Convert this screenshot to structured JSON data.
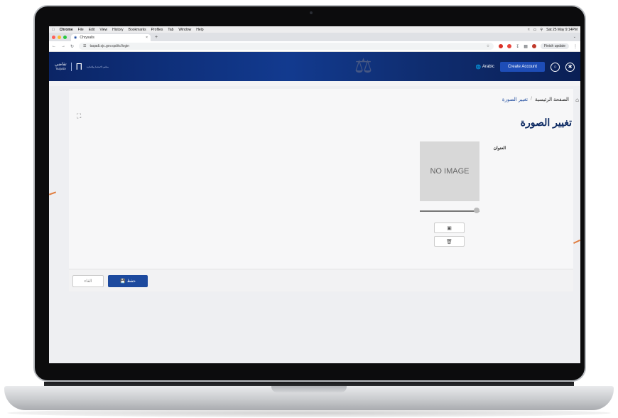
{
  "menubar": {
    "app": "Chrome",
    "items": [
      "File",
      "Edit",
      "View",
      "History",
      "Bookmarks",
      "Profiles",
      "Tab",
      "Window",
      "Help"
    ],
    "datetime": "Sat 25 May 9:14PM"
  },
  "browser": {
    "tab_title": "Chrysalis",
    "url": "taqadi.sjc.gov.qa/itc/login",
    "finish_update": "Finish update"
  },
  "header": {
    "logo_text": "تقاضي",
    "logo_sub": "TAQADI",
    "council_text": "مجلس الاستثمار والتجارة",
    "language": "Arabic",
    "create_account": "Create Account"
  },
  "breadcrumb": {
    "home": "الصفحة الرئيسية",
    "separator": "/",
    "current": "تغيير الصورة"
  },
  "page": {
    "title": "تغيير الصورة",
    "address_label": "العنوان",
    "no_image": "NO IMAGE",
    "zoom_level": 1.0
  },
  "footer": {
    "save": "حفظ",
    "cancel": "الغاء"
  },
  "colors": {
    "header_bg": "#0f2d70",
    "primary": "#1d4a9e",
    "title": "#0d2a63"
  }
}
